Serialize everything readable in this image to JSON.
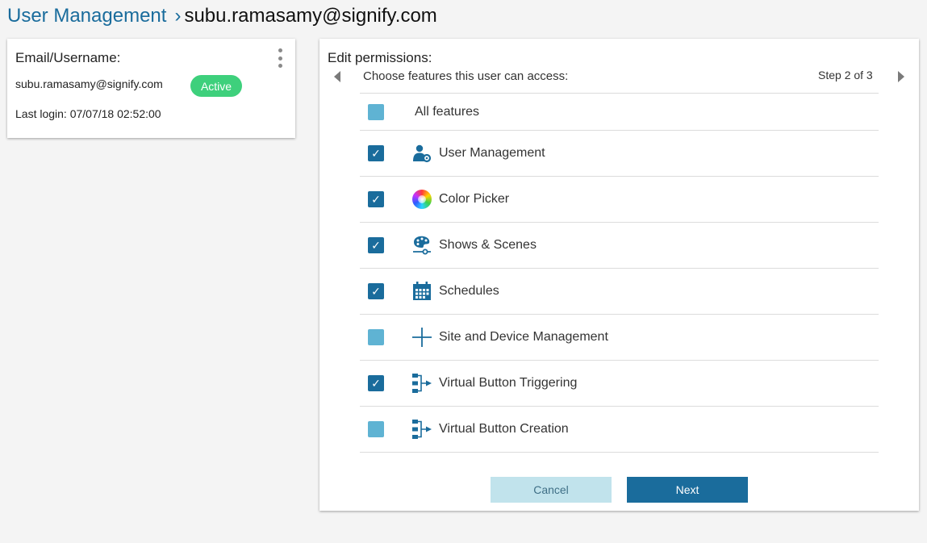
{
  "breadcrumb": {
    "parent": "User Management",
    "separator": "›",
    "current": "subu.ramasamy@signify.com"
  },
  "user_card": {
    "label": "Email/Username:",
    "email": "subu.ramasamy@signify.com",
    "status": "Active",
    "last_login": "Last login: 07/07/18 02:52:00"
  },
  "permissions": {
    "title": "Edit permissions:",
    "subtitle": "Choose features this user can access:",
    "step": "Step 2 of 3",
    "all_features": {
      "label": "All features",
      "checked": false
    },
    "features": [
      {
        "label": "User Management",
        "checked": true,
        "icon": "user-gear-icon"
      },
      {
        "label": "Color Picker",
        "checked": true,
        "icon": "color-wheel-icon"
      },
      {
        "label": "Shows & Scenes",
        "checked": true,
        "icon": "palette-icon"
      },
      {
        "label": "Schedules",
        "checked": true,
        "icon": "calendar-icon"
      },
      {
        "label": "Site and Device Management",
        "checked": false,
        "icon": "crosshair-icon"
      },
      {
        "label": "Virtual Button Triggering",
        "checked": true,
        "icon": "flow-icon"
      },
      {
        "label": "Virtual Button Creation",
        "checked": false,
        "icon": "flow-icon"
      }
    ],
    "cancel_label": "Cancel",
    "next_label": "Next"
  },
  "colors": {
    "brand_blue": "#1a6c9c",
    "light_blue": "#5fb3d3",
    "active_green": "#3ed07c",
    "cancel_bg": "#c1e3ec"
  }
}
